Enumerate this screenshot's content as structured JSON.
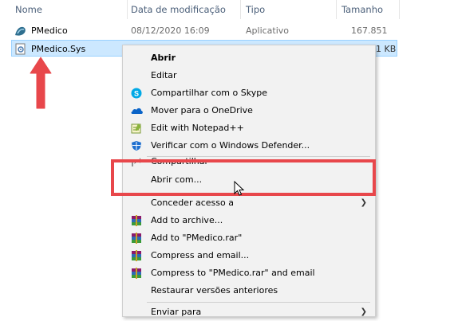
{
  "header": {
    "col_name": "Nome",
    "col_date": "Data de modificação",
    "col_type": "Tipo",
    "col_size": "Tamanho"
  },
  "files": [
    {
      "name": "PMedico",
      "date": "08/12/2020 16:09",
      "type": "Aplicativo",
      "size": "167.851 KB",
      "icon": "app-icon"
    },
    {
      "name": "PMedico.Sys",
      "date": "",
      "type": "",
      "size": "1 KB",
      "icon": "sys-file-icon"
    }
  ],
  "menu": {
    "items": [
      {
        "label": "Abrir",
        "icon": "",
        "bold": true
      },
      {
        "label": "Editar",
        "icon": ""
      },
      {
        "label": "Compartilhar com o Skype",
        "icon": "skype-icon"
      },
      {
        "label": "Mover para o OneDrive",
        "icon": "onedrive-icon"
      },
      {
        "label": "Edit with Notepad++",
        "icon": "notepadpp-icon"
      },
      {
        "label": "Verificar com o Windows Defender...",
        "icon": "defender-icon"
      },
      {
        "label": "Compartilhar",
        "icon": "share-icon"
      },
      {
        "label": "Abrir com...",
        "icon": ""
      },
      {
        "label": "Conceder acesso a",
        "icon": "",
        "submenu": true
      },
      {
        "label": "Add to archive...",
        "icon": "winrar-icon"
      },
      {
        "label": "Add to \"PMedico.rar\"",
        "icon": "winrar-icon"
      },
      {
        "label": "Compress and email...",
        "icon": "winrar-icon"
      },
      {
        "label": "Compress to \"PMedico.rar\" and email",
        "icon": "winrar-icon"
      },
      {
        "label": "Restaurar versões anteriores",
        "icon": ""
      },
      {
        "label": "Enviar para",
        "icon": "",
        "submenu": true
      }
    ]
  },
  "colors": {
    "highlight": "#e8474b",
    "selection": "#cce8ff",
    "arrow": "#e8474b"
  }
}
